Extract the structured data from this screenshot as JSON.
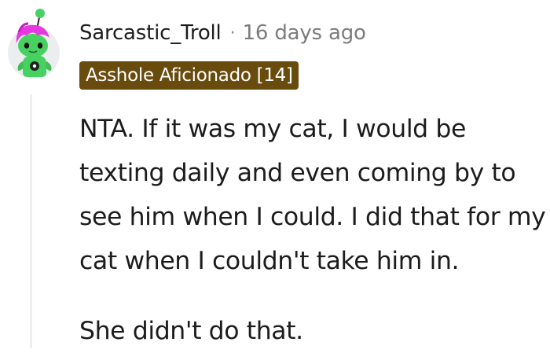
{
  "comment": {
    "author": "Sarcastic_Troll",
    "separator": "·",
    "timestamp": "16 days ago",
    "flair": "Asshole Aficionado [14]",
    "body": [
      "NTA. If it was my cat, I would be texting daily and even coming by to see him when I could. I did that for my cat when I couldn't take him in.",
      "She didn't do that."
    ]
  },
  "colors": {
    "flair_background": "#694b0e",
    "flair_text": "#ffffff",
    "timestamp_text": "#7c7c7c",
    "thread_line": "#edeff1",
    "avatar_body": "#46d160",
    "avatar_hair": "#e638e0"
  },
  "icons": {
    "avatar": "snoo-avatar-icon"
  }
}
